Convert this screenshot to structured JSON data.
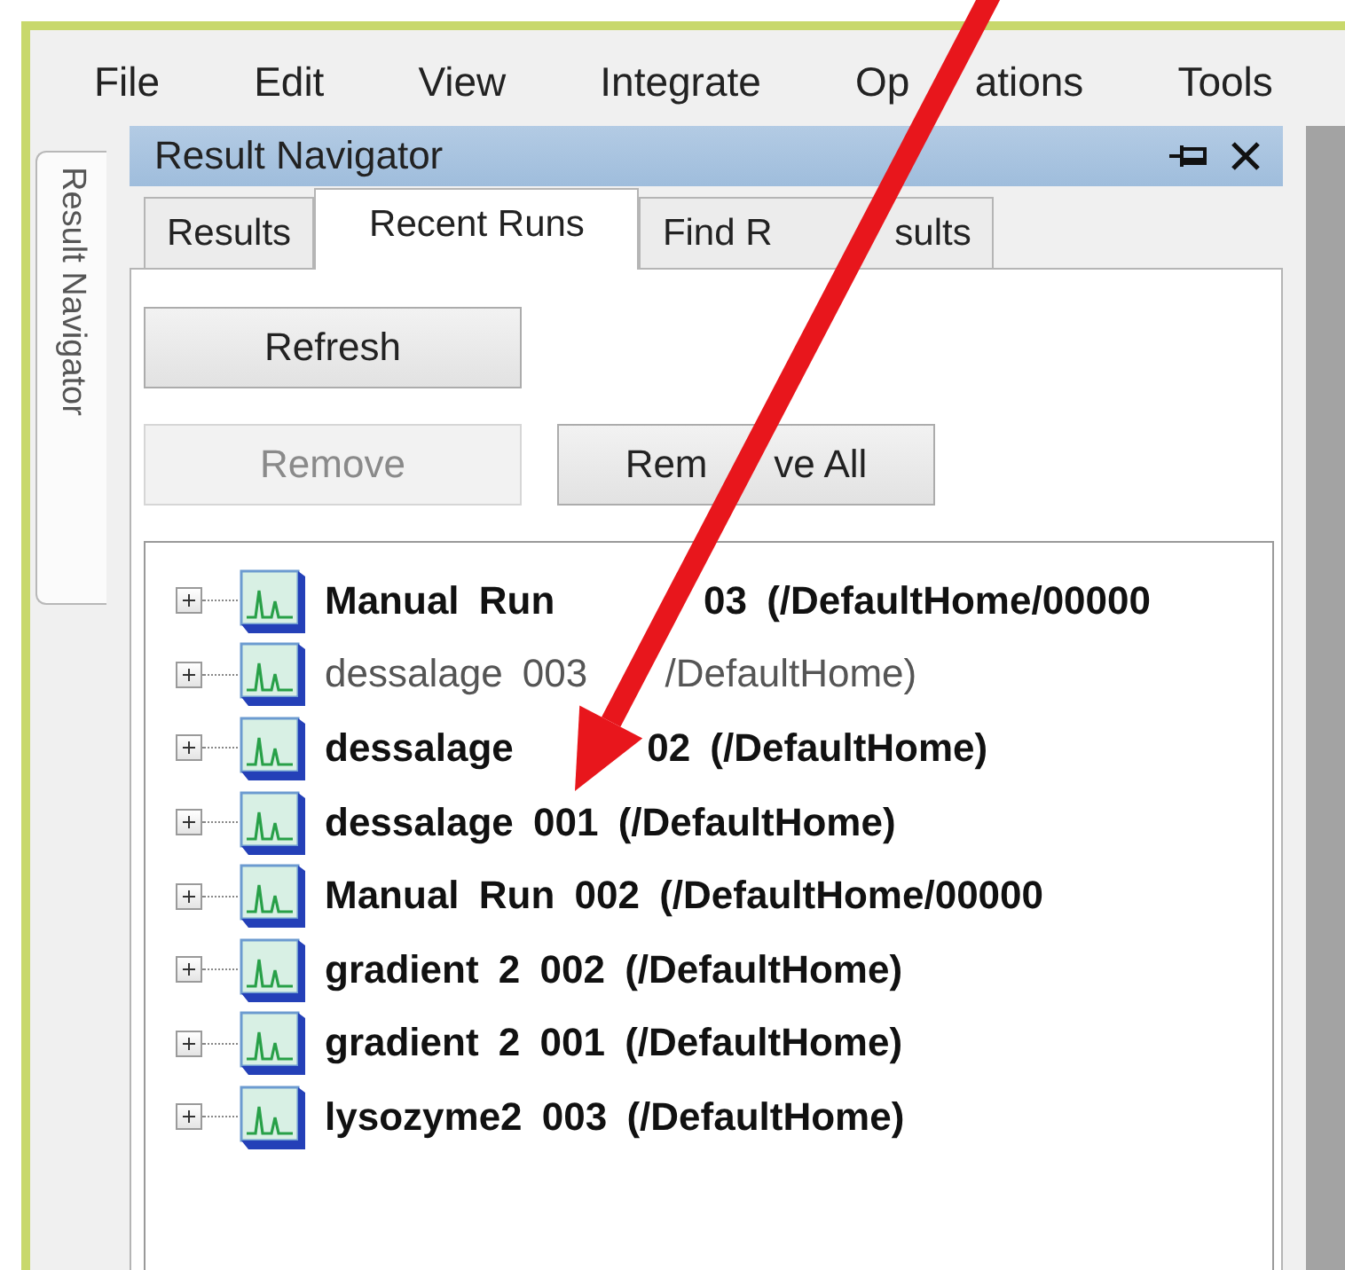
{
  "menu": [
    {
      "label": "File"
    },
    {
      "label": "Edit"
    },
    {
      "label": "View"
    },
    {
      "label": "Integrate"
    },
    {
      "parts": [
        "Op",
        "ations"
      ]
    },
    {
      "label": "Tools"
    }
  ],
  "side_tab": {
    "label": "Result Navigator"
  },
  "panel": {
    "title": "Result Navigator"
  },
  "tabs": [
    {
      "label": "Results",
      "selected": false
    },
    {
      "label": "Recent Runs",
      "selected": true
    },
    {
      "parts": [
        "Find R",
        "sults"
      ],
      "selected": false
    }
  ],
  "buttons": [
    {
      "label": "Refresh",
      "disabled": false
    },
    {
      "label": "Remove",
      "disabled": true
    },
    {
      "parts": [
        "Rem",
        "ve All"
      ],
      "disabled": false
    }
  ],
  "runs": [
    {
      "parts": [
        "Manual Run",
        "03 (/DefaultHome/00000"
      ],
      "bold": true,
      "expanded": false
    },
    {
      "parts": [
        "dessalage 003",
        "/DefaultHome)"
      ],
      "bold": false,
      "expanded": false
    },
    {
      "parts": [
        "dessalage",
        "02 (/DefaultHome)"
      ],
      "bold": true,
      "expanded": false
    },
    {
      "label": "dessalage 001 (/DefaultHome)",
      "bold": true,
      "expanded": false
    },
    {
      "label": "Manual Run 002 (/DefaultHome/00000",
      "bold": true,
      "expanded": false
    },
    {
      "label": "gradient 2 002 (/DefaultHome)",
      "bold": true,
      "expanded": false
    },
    {
      "label": "gradient 2 001 (/DefaultHome)",
      "bold": true,
      "expanded": false
    },
    {
      "label": "lysozyme2 003 (/DefaultHome)",
      "bold": true,
      "expanded": false
    }
  ],
  "annotation": {
    "kind": "arrow"
  }
}
